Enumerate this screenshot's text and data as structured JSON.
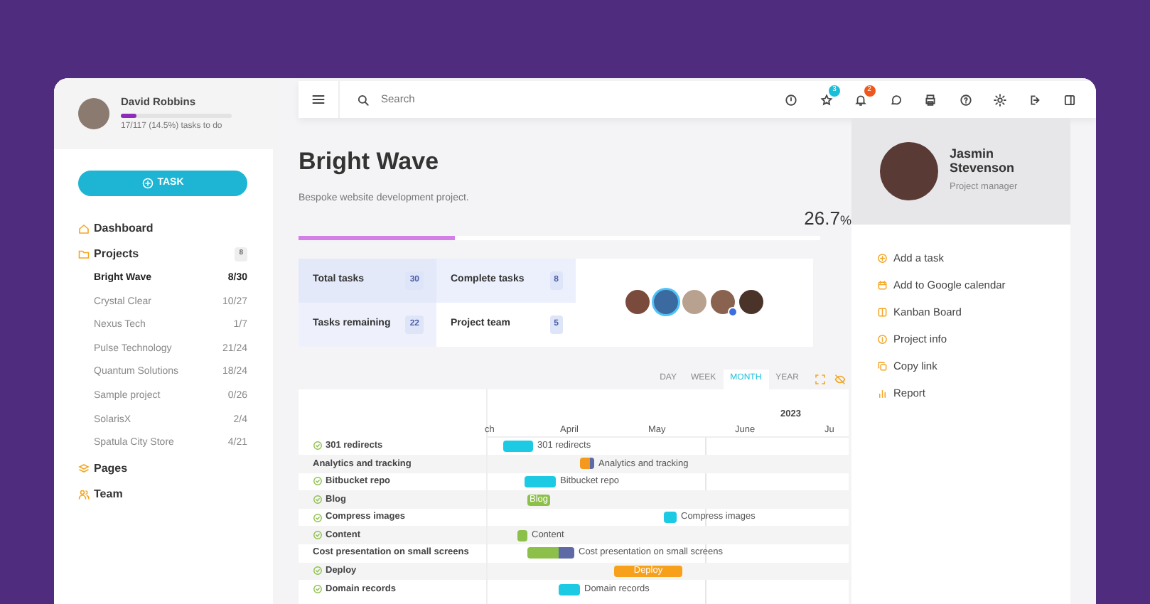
{
  "sidebar": {
    "user": {
      "name": "David Robbins",
      "level": 0.145,
      "summary": "17/117 (14.5%) tasks to do"
    },
    "task_button": "TASK",
    "nav": [
      {
        "label": "Dashboard"
      },
      {
        "label": "Projects",
        "badge": "8",
        "children": [
          {
            "name": "Bright Wave",
            "count": "8/30",
            "selected": true
          },
          {
            "name": "Crystal Clear",
            "count": "10/27",
            "selected": false
          },
          {
            "name": "Nexus Tech",
            "count": "1/7",
            "selected": false
          },
          {
            "name": "Pulse Technology",
            "count": "21/24",
            "selected": false
          },
          {
            "name": "Quantum Solutions",
            "count": "18/24",
            "selected": false
          },
          {
            "name": "Sample project",
            "count": "0/26",
            "selected": false
          },
          {
            "name": "SolarisX",
            "count": "2/4",
            "selected": false
          },
          {
            "name": "Spatula City Store",
            "count": "4/21",
            "selected": false
          }
        ]
      },
      {
        "label": "Pages"
      },
      {
        "label": "Team"
      }
    ]
  },
  "topbar": {
    "search": {
      "placeholder": "Search"
    },
    "favorites_badge": "3",
    "notifications_badge": "2"
  },
  "project": {
    "title": "Bright Wave",
    "description": "Bespoke website development project.",
    "percent": "26.7",
    "percent_unit": "%",
    "level": 0.3,
    "stats": [
      {
        "label": "Total tasks",
        "value": "30"
      },
      {
        "label": "Complete tasks",
        "value": "8"
      },
      {
        "label": "Tasks remaining",
        "value": "22"
      },
      {
        "label": "Project team",
        "value": "5"
      }
    ]
  },
  "gantt": {
    "views": [
      {
        "label": "DAY",
        "selected": false
      },
      {
        "label": "WEEK",
        "selected": false
      },
      {
        "label": "MONTH",
        "selected": true
      },
      {
        "label": "YEAR",
        "selected": false
      }
    ],
    "year": "2023",
    "months": [
      "ch",
      "April",
      "May",
      "June",
      "Ju"
    ],
    "tasks": [
      {
        "name": "301 redirects",
        "done": true,
        "bar_label": "301 redirects",
        "label_inside": false,
        "segments": [
          {
            "color": "#1ccbe3"
          }
        ]
      },
      {
        "name": "Analytics and tracking",
        "done": false,
        "bar_label": "Analytics and tracking",
        "label_inside": false,
        "segments": [
          {
            "color": "#f39a1e"
          },
          {
            "color": "#5d6aa6"
          }
        ]
      },
      {
        "name": "Bitbucket repo",
        "done": true,
        "bar_label": "Bitbucket repo",
        "label_inside": false,
        "segments": [
          {
            "color": "#1ccbe3"
          }
        ]
      },
      {
        "name": "Blog",
        "done": true,
        "bar_label": "Blog",
        "label_inside": true,
        "segments": [
          {
            "color": "#8cc04b"
          }
        ]
      },
      {
        "name": "Compress images",
        "done": true,
        "bar_label": "Compress images",
        "label_inside": false,
        "segments": [
          {
            "color": "#1ccbe3"
          }
        ]
      },
      {
        "name": "Content",
        "done": true,
        "bar_label": "Content",
        "label_inside": false,
        "segments": [
          {
            "color": "#8cc04b"
          }
        ]
      },
      {
        "name": "Cost presentation on small screens",
        "done": false,
        "bar_label": "Cost presentation on small screens",
        "label_inside": false,
        "segments": [
          {
            "color": "#8cc04b"
          },
          {
            "color": "#5d6aa6"
          }
        ]
      },
      {
        "name": "Deploy",
        "done": true,
        "bar_label": "Deploy",
        "label_inside": true,
        "segments": [
          {
            "color": "#f7a01c"
          }
        ]
      },
      {
        "name": "Domain records",
        "done": true,
        "bar_label": "Domain records",
        "label_inside": false,
        "segments": [
          {
            "color": "#1ccbe3"
          }
        ]
      }
    ]
  },
  "manager": {
    "name": "Jasmin Stevenson",
    "role": "Project manager",
    "actions": [
      "Add a task",
      "Add to Google calendar",
      "Kanban Board",
      "Project info",
      "Copy link",
      "Report"
    ]
  }
}
